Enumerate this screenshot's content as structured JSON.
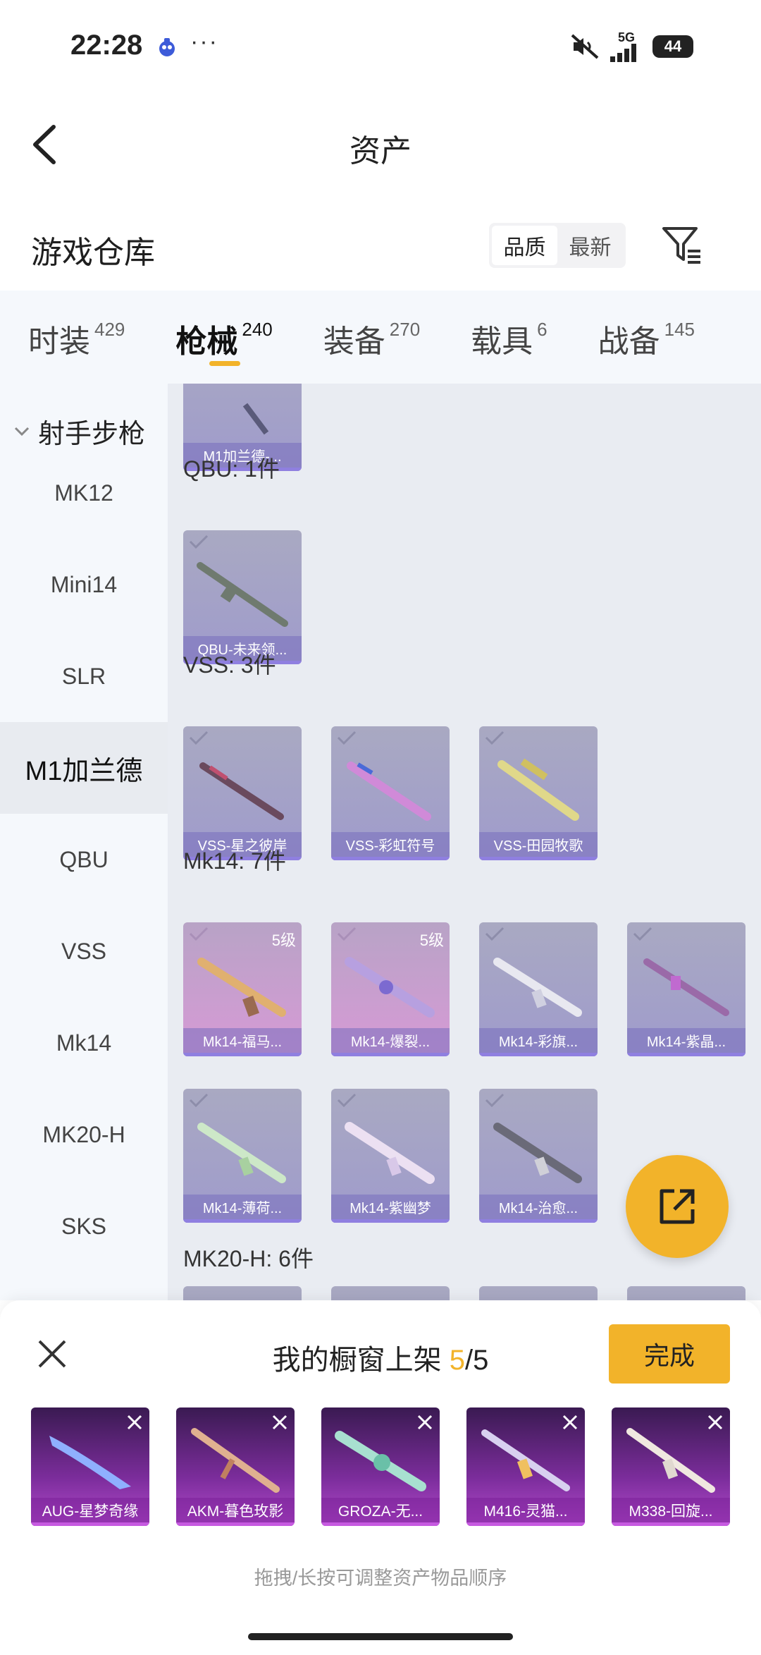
{
  "status": {
    "time": "22:28",
    "battery": "44",
    "network": "5G",
    "more": "···"
  },
  "header": {
    "title": "资产"
  },
  "warehouse": {
    "title": "游戏仓库",
    "sort": [
      "品质",
      "最新"
    ]
  },
  "tabs": [
    {
      "label": "时装",
      "count": "429"
    },
    {
      "label": "枪械",
      "count": "240"
    },
    {
      "label": "装备",
      "count": "270"
    },
    {
      "label": "载具",
      "count": "6"
    },
    {
      "label": "战备",
      "count": "145"
    }
  ],
  "sidebar": {
    "group": "射手步枪",
    "items": [
      "MK12",
      "Mini14",
      "SLR",
      "M1加兰德",
      "QBU",
      "VSS",
      "Mk14",
      "MK20-H",
      "SKS"
    ]
  },
  "sections": {
    "m1": {
      "cards": [
        "M1加兰德-..."
      ]
    },
    "qbu": {
      "title": "QBU: 1件",
      "cards": [
        "QBU-未来领..."
      ]
    },
    "vss": {
      "title": "VSS: 3件",
      "cards": [
        "VSS-星之彼岸",
        "VSS-彩虹符号",
        "VSS-田园牧歌"
      ]
    },
    "mk14": {
      "title": "Mk14: 7件",
      "level": "5级",
      "cards": [
        "Mk14-福马...",
        "Mk14-爆裂...",
        "Mk14-彩旗...",
        "Mk14-紫晶...",
        "Mk14-薄荷...",
        "Mk14-紫幽梦",
        "Mk14-治愈..."
      ]
    },
    "mk20": {
      "title": "MK20-H: 6件"
    }
  },
  "sheet": {
    "title_prefix": "我的橱窗上架 ",
    "current": "5",
    "total": "/5",
    "done": "完成",
    "items": [
      "AUG-星梦奇缘",
      "AKM-暮色玫影",
      "GROZA-无...",
      "M416-灵猫...",
      "M338-回旋..."
    ],
    "hint": "拖拽/长按可调整资产物品顺序"
  },
  "colors": {
    "accent": "#f2b32a",
    "card_purple": "#9f9bcc",
    "card_pink": "#d79ad6",
    "shelf_purple": "#7c2d9c"
  }
}
